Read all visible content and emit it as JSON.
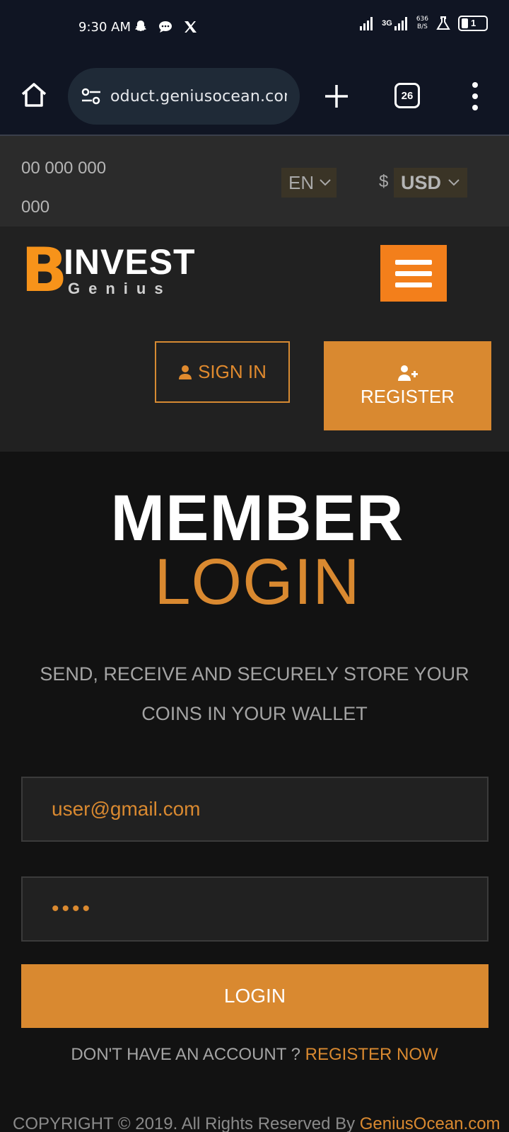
{
  "status_bar": {
    "time": "9:30 AM",
    "network": "3G",
    "net_speed_value": "636",
    "net_speed_unit": "B/S",
    "battery": "1"
  },
  "browser": {
    "url": "oduct.geniusocean.com",
    "tab_count": "26"
  },
  "topbar": {
    "phone": "00 000 000 000",
    "language": "EN",
    "currency_symbol": "$",
    "currency": "USD"
  },
  "header": {
    "logo_initial": "B",
    "logo_name": "INVEST",
    "logo_sub": "Genius",
    "signin_label": "SIGN IN",
    "register_label": "REGISTER"
  },
  "main": {
    "title_line1": "MEMBER",
    "title_line2": "LOGIN",
    "subtitle": "SEND, RECEIVE AND SECURELY STORE YOUR COINS IN YOUR WALLET",
    "email_value": "user@gmail.com",
    "password_value": "••••",
    "login_label": "LOGIN",
    "no_account_text": "DON'T HAVE AN ACCOUNT ?",
    "register_now_label": "REGISTER NOW"
  },
  "footer": {
    "copyright_text": "COPYRIGHT © 2019. All Rights Reserved By",
    "copyright_link": "GeniusOcean.com"
  },
  "colors": {
    "accent": "#d98930",
    "hamburger": "#f37f1b",
    "bitcoin": "#f7931a",
    "page_bg": "#121212",
    "header_bg": "#212121",
    "browser_bg": "#101523"
  }
}
